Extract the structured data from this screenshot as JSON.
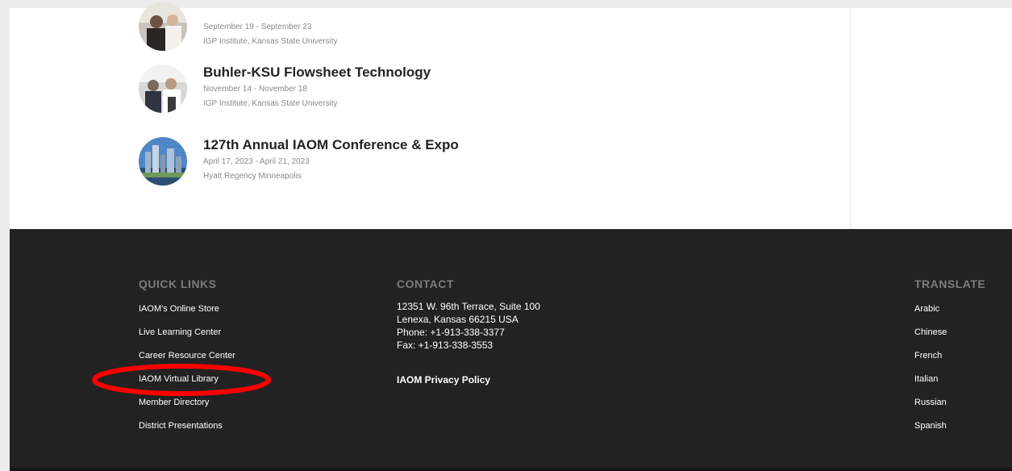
{
  "events": [
    {
      "title": "",
      "date": "September 19 - September 23",
      "venue": "IGP Institute, Kansas State University",
      "image_icon": "event-photo-people"
    },
    {
      "title": "Buhler-KSU Flowsheet Technology",
      "date": "November 14 - November 18",
      "venue": "IGP Institute, Kansas State University",
      "image_icon": "event-photo-people"
    },
    {
      "title": "127th Annual IAOM Conference & Expo",
      "date": "April 17, 2023 - April 21, 2023",
      "venue": "Hyatt Regency Minneapolis",
      "image_icon": "event-photo-city"
    }
  ],
  "footer": {
    "quick_links": {
      "heading": "QUICK LINKS",
      "items": [
        "IAOM's Online Store",
        "Live Learning Center",
        "Career Resource Center",
        "IAOM Virtual Library",
        "Member Directory",
        "District Presentations"
      ]
    },
    "contact": {
      "heading": "CONTACT",
      "address_line1": "12351 W. 96th Terrace, Suite 100",
      "address_line2": "Lenexa, Kansas 66215 USA",
      "phone": "Phone: +1-913-338-3377",
      "fax": "Fax: +1-913-338-3553",
      "privacy_policy": "IAOM Privacy Policy"
    },
    "translate": {
      "heading": "TRANSLATE",
      "languages": [
        "Arabic",
        "Chinese",
        "French",
        "Italian",
        "Russian",
        "Spanish"
      ]
    }
  },
  "colors": {
    "footer_bg": "#222222",
    "highlight": "#ff0000"
  }
}
